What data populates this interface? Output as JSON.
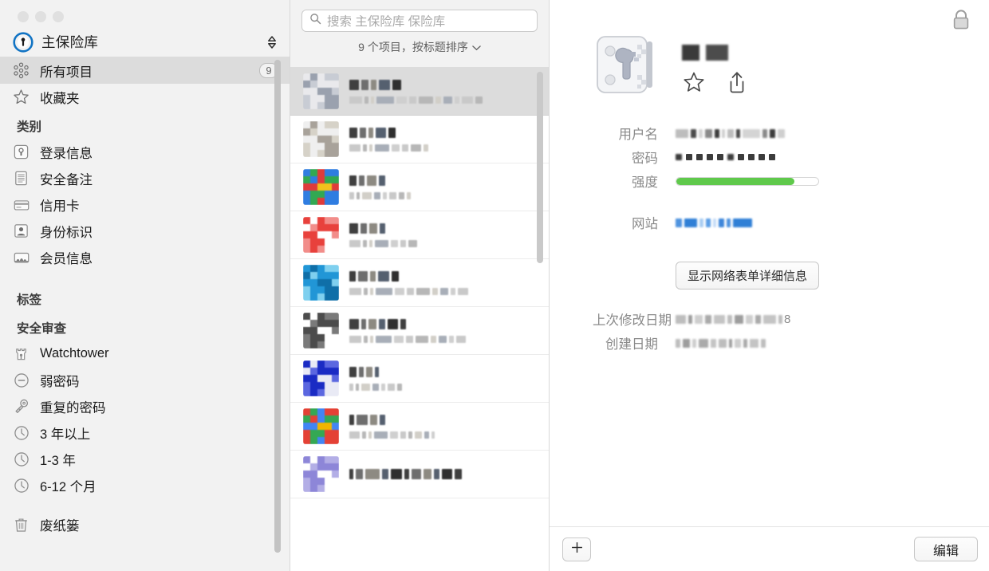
{
  "window": {
    "traffic_lights": [
      "close",
      "minimize",
      "zoom"
    ],
    "accent_color": "#1274c4",
    "strength_color": "#5fc94b",
    "sidebar_bg": "#f2f2f2",
    "selected_row_bg": "#dcdcdc"
  },
  "sidebar": {
    "vault": {
      "name": "主保险库",
      "logo_icon": "1password-logo-icon",
      "switch_icon": "chevron-up-down-icon"
    },
    "rows": [
      {
        "label": "所有项目",
        "icon": "all-items-icon",
        "count": "9",
        "selected": true
      },
      {
        "label": "收藏夹",
        "icon": "star-icon",
        "count": "",
        "selected": false
      }
    ],
    "groups": [
      {
        "title": "类别",
        "items": [
          {
            "label": "登录信息",
            "icon": "login-icon"
          },
          {
            "label": "安全备注",
            "icon": "secure-note-icon"
          },
          {
            "label": "信用卡",
            "icon": "credit-card-icon"
          },
          {
            "label": "身份标识",
            "icon": "identity-icon"
          },
          {
            "label": "会员信息",
            "icon": "membership-icon"
          }
        ]
      },
      {
        "title": "标签",
        "items": []
      },
      {
        "title": "安全审查",
        "items": [
          {
            "label": "Watchtower",
            "icon": "watchtower-icon"
          },
          {
            "label": "弱密码",
            "icon": "weak-password-icon"
          },
          {
            "label": "重复的密码",
            "icon": "duplicate-password-key-icon"
          },
          {
            "label": "3 年以上",
            "icon": "clock-icon"
          },
          {
            "label": "1-3 年",
            "icon": "clock-icon"
          },
          {
            "label": "6-12 个月",
            "icon": "clock-icon"
          }
        ]
      }
    ],
    "trash": {
      "label": "废纸篓",
      "icon": "trash-icon"
    }
  },
  "list": {
    "search": {
      "placeholder": "搜索 主保险库 保险库",
      "icon": "search-icon",
      "value": ""
    },
    "meta": {
      "text": "9 个项目，按标题排序",
      "chevron_icon": "chevron-down-icon"
    },
    "items": [
      {
        "icon_name": "redacted-item-icon-1",
        "icon_colors": [
          "#e9e9ec",
          "#c8ccd4",
          "#9aa1ae"
        ],
        "title_blocks": [
          12,
          9,
          7,
          14,
          11
        ],
        "sub_blocks": [
          16,
          5,
          4,
          22,
          13,
          9,
          18,
          7,
          11,
          6,
          14,
          9
        ],
        "selected": true
      },
      {
        "icon_name": "redacted-item-icon-2",
        "icon_colors": [
          "#efefef",
          "#d6d2c8",
          "#a8a29a"
        ],
        "title_blocks": [
          10,
          8,
          6,
          13,
          9
        ],
        "sub_blocks": [
          14,
          5,
          4,
          18,
          10,
          8,
          13,
          6
        ],
        "selected": false
      },
      {
        "icon_name": "redacted-item-icon-3",
        "icon_colors": [
          "#2f7de1",
          "#f2c21c",
          "#32a852",
          "#e03b3b"
        ],
        "title_blocks": [
          9,
          7,
          12,
          8
        ],
        "sub_blocks": [
          6,
          4,
          12,
          8,
          5,
          9,
          7,
          5
        ],
        "selected": false
      },
      {
        "icon_name": "redacted-item-icon-4",
        "icon_colors": [
          "#e8413c",
          "#f28d8a",
          "#ffffff"
        ],
        "title_blocks": [
          11,
          8,
          10,
          7
        ],
        "sub_blocks": [
          14,
          5,
          4,
          17,
          9,
          7,
          11
        ],
        "selected": false
      },
      {
        "icon_name": "redacted-item-icon-5",
        "icon_colors": [
          "#2196d6",
          "#7fd0ef",
          "#0f6fa8"
        ],
        "title_blocks": [
          8,
          12,
          7,
          14,
          9
        ],
        "sub_blocks": [
          15,
          5,
          4,
          21,
          12,
          9,
          17,
          7,
          10,
          6,
          13
        ],
        "selected": false
      },
      {
        "icon_name": "redacted-item-icon-6",
        "icon_colors": [
          "#4c4c4c",
          "#7a7a7a",
          "#ffffff"
        ],
        "title_blocks": [
          12,
          6,
          10,
          8,
          13,
          7
        ],
        "sub_blocks": [
          15,
          5,
          4,
          20,
          12,
          9,
          16,
          7,
          10,
          6,
          12
        ],
        "selected": false
      },
      {
        "icon_name": "redacted-item-icon-7",
        "icon_colors": [
          "#1a2bc4",
          "#5b67e0",
          "#e9eaf5"
        ],
        "title_blocks": [
          9,
          6,
          8,
          5
        ],
        "sub_blocks": [
          5,
          4,
          11,
          8,
          5,
          9,
          6
        ],
        "selected": false
      },
      {
        "icon_name": "redacted-item-icon-8",
        "icon_colors": [
          "#e44135",
          "#f2b500",
          "#34a853",
          "#4285f4"
        ],
        "title_blocks": [
          6,
          14,
          9,
          7
        ],
        "sub_blocks": [
          13,
          5,
          4,
          17,
          10,
          7,
          5,
          9,
          6,
          4
        ],
        "selected": false
      },
      {
        "icon_name": "redacted-item-icon-9",
        "icon_colors": [
          "#8d86d8",
          "#b3aee6",
          "#ffffff"
        ],
        "title_blocks": [
          5,
          9,
          18,
          8,
          14,
          6,
          12,
          10,
          7,
          13,
          9
        ],
        "sub_blocks": [],
        "selected": false
      }
    ]
  },
  "detail": {
    "lock_icon": "lock-icon",
    "item_icon": "key-card-icon",
    "title_blocks": [
      22,
      28
    ],
    "actions": [
      {
        "icon": "favorite-star-icon",
        "label": "收藏"
      },
      {
        "icon": "share-icon",
        "label": "共享"
      }
    ],
    "fields": [
      {
        "label": "用户名",
        "type": "redacted-text",
        "blocks": [
          16,
          7,
          5,
          9,
          6,
          4,
          8,
          5,
          22,
          6,
          7,
          9
        ]
      },
      {
        "label": "密码",
        "type": "redacted-dots",
        "dot_count": 10
      },
      {
        "label": "强度",
        "type": "strength-bar",
        "percent": 83,
        "color": "#5fc94b"
      },
      {
        "label": "网站",
        "type": "redacted-link",
        "blocks": [
          8,
          16,
          5,
          6,
          4,
          7,
          5,
          24
        ]
      }
    ],
    "webform_button": "显示网络表单详细信息",
    "dates": [
      {
        "label": "上次修改日期",
        "blocks": [
          13,
          5,
          10,
          8,
          14,
          6,
          11,
          9,
          7,
          16,
          5
        ],
        "suffix": "8"
      },
      {
        "label": "创建日期",
        "blocks": [
          6,
          9,
          5,
          12,
          7,
          10,
          4,
          8,
          5,
          11,
          6
        ],
        "suffix": ""
      }
    ],
    "footer": {
      "add_label": "+",
      "add_icon": "plus-icon",
      "edit_label": "编辑"
    }
  }
}
